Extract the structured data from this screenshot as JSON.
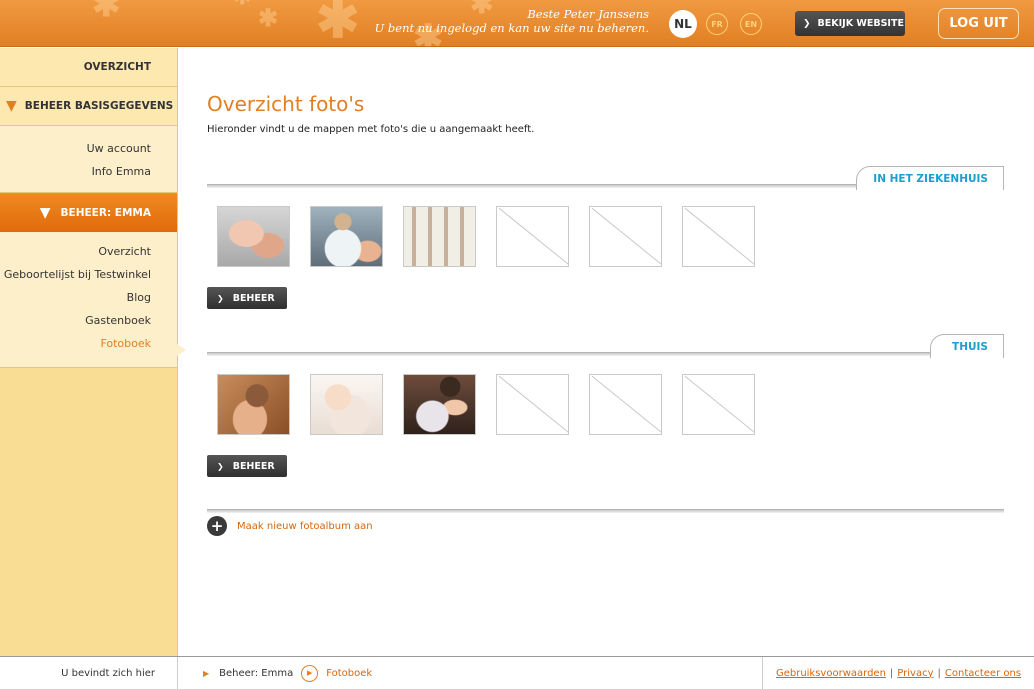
{
  "header": {
    "greeting_name": "Beste Peter Janssens",
    "greeting_text": "U bent nu ingelogd en kan uw site nu beheren.",
    "languages": [
      {
        "code": "NL",
        "active": true
      },
      {
        "code": "FR",
        "active": false
      },
      {
        "code": "EN",
        "active": false
      }
    ],
    "view_site_label": "BEKIJK WEBSITE",
    "logout_label": "LOG UIT"
  },
  "sidebar": {
    "overview_label": "OVERZICHT",
    "basis_section_label": "BEHEER BASISGEGEVENS",
    "basis_items": [
      "Uw account",
      "Info Emma"
    ],
    "emma_section_label": "BEHEER: EMMA",
    "emma_items": [
      "Overzicht",
      "Geboortelijst bij Testwinkel",
      "Blog",
      "Gastenboek",
      "Fotoboek"
    ],
    "current_item": "Fotoboek"
  },
  "main": {
    "title": "Overzicht foto's",
    "intro": "Hieronder vindt u de mappen met foto's die u aangemaakt heeft.",
    "albums": [
      {
        "name": "IN HET ZIEKENHUIS",
        "manage_label": "BEHEER",
        "photos": [
          "baby-hands-photo",
          "nurse-bathing-baby-photo",
          "medical-staff-group-photo"
        ],
        "empty_slots": 3
      },
      {
        "name": "THUIS",
        "manage_label": "BEHEER",
        "photos": [
          "mother-baby-photo",
          "smiling-baby-photo",
          "father-baby-photo"
        ],
        "empty_slots": 3
      }
    ],
    "new_album_label": "Maak nieuw fotoalbum aan"
  },
  "footer": {
    "location_label": "U bevindt zich hier",
    "breadcrumbs": [
      "Beheer: Emma",
      "Fotoboek"
    ],
    "links": [
      "Gebruiksvoorwaarden",
      "Privacy",
      "Contacteer ons"
    ]
  },
  "colors": {
    "accent_orange": "#e27f22",
    "sidebar_bg": "#f9dd94",
    "album_title_blue": "#1b9fd0",
    "button_dark": "#3a3a3a"
  }
}
